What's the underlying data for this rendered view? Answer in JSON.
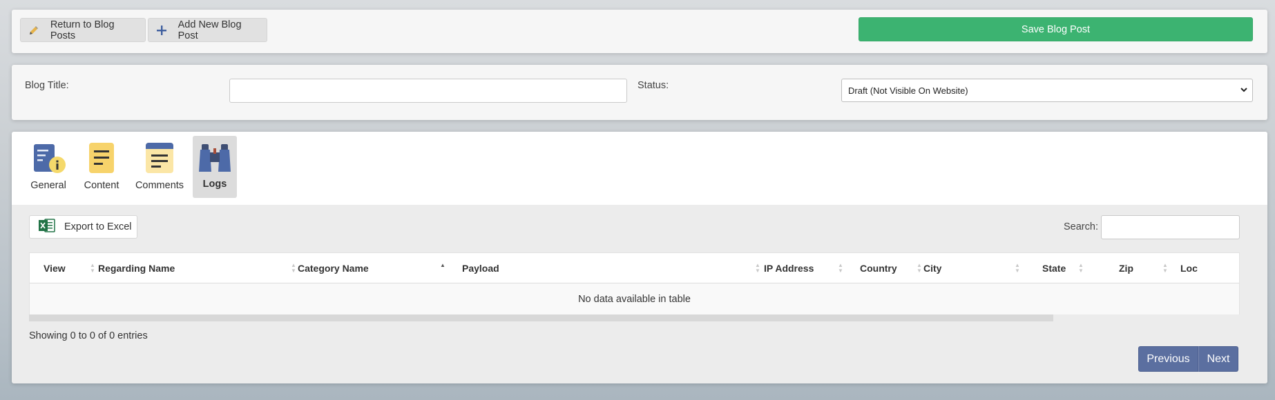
{
  "toolbar": {
    "return_label": "Return to Blog Posts",
    "add_label": "Add New Blog Post",
    "save_label": "Save Blog Post"
  },
  "fields": {
    "title_label": "Blog Title:",
    "title_value": "",
    "status_label": "Status:",
    "status_value": "Draft (Not Visible On Website)"
  },
  "tabs": [
    {
      "label": "General",
      "icon": "document-info-icon"
    },
    {
      "label": "Content",
      "icon": "notepad-icon"
    },
    {
      "label": "Comments",
      "icon": "comments-icon"
    },
    {
      "label": "Logs",
      "icon": "binoculars-icon",
      "active": true
    }
  ],
  "logs": {
    "export_label": "Export to Excel",
    "search_label": "Search:",
    "search_value": "",
    "columns": [
      "View",
      "Regarding Name",
      "Category Name",
      "Payload",
      "IP Address",
      "Country",
      "City",
      "State",
      "Zip",
      "Loc"
    ],
    "sorted_column": "Category Name",
    "empty_message": "No data available in table",
    "info": "Showing 0 to 0 of 0 entries",
    "prev_label": "Previous",
    "next_label": "Next"
  },
  "colors": {
    "save_button": "#3cb371",
    "pager_button": "#5b6fa0"
  }
}
